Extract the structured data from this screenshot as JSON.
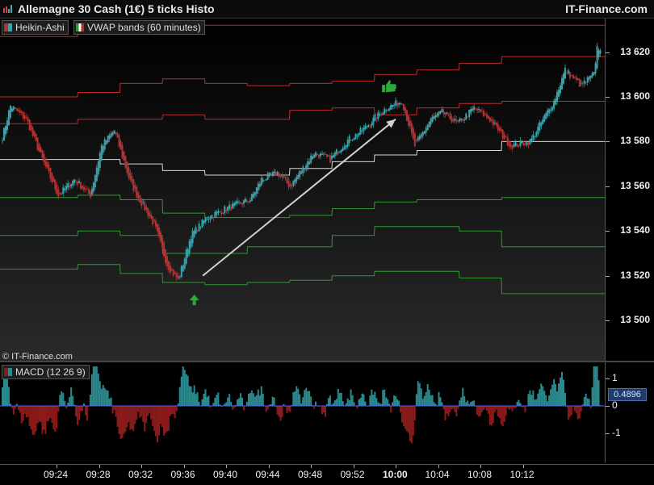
{
  "window": {
    "title": "Allemagne 30 Cash (1€) 5 ticks Histo",
    "brand": "IT-Finance.com",
    "copyright": "© IT-Finance.com"
  },
  "legends": {
    "main": [
      {
        "label": "Heikin-Ashi",
        "icon": "heikin-ashi-icon",
        "color": "#5a8fb0"
      },
      {
        "label": "VWAP bands (60 minutes)",
        "icon": "vwap-bands-icon",
        "color": "#c0392b"
      }
    ],
    "macd": {
      "label": "MACD (12 26 9)",
      "icon": "macd-icon",
      "color": "#8b0000"
    }
  },
  "colors": {
    "bull": "#3ea0a8",
    "bear": "#b03232",
    "upper_band": "#c0282a",
    "vwap": "#d8d8d8",
    "lower_band": "#2e9a2e",
    "macd_pos": "#2a8a8e",
    "macd_neg": "#8b1a1a",
    "arrow": "#d0d0d0",
    "signal_up": "#2eaa3a"
  },
  "chart_data": [
    {
      "type": "candlestick",
      "title": "Allemagne 30 Cash (1€) 5 ticks Histo",
      "ylim": [
        13482,
        13635
      ],
      "y_ticks": [
        13500,
        13520,
        13540,
        13560,
        13580,
        13600,
        13620
      ],
      "y_tick_labels": [
        "13 500",
        "13 520",
        "13 540",
        "13 560",
        "13 580",
        "13 600",
        "13 620"
      ],
      "x_tick_labels": [
        "09:24",
        "09:28",
        "09:32",
        "09:36",
        "09:40",
        "09:44",
        "09:48",
        "09:52",
        "10:00",
        "10:04",
        "10:08",
        "10:12"
      ],
      "x_ticks_bold": [
        "10:00"
      ],
      "grid": false,
      "price_anchors": [
        [
          0,
          13582
        ],
        [
          5,
          13596
        ],
        [
          15,
          13590
        ],
        [
          25,
          13572
        ],
        [
          35,
          13556
        ],
        [
          45,
          13563
        ],
        [
          55,
          13556
        ],
        [
          62,
          13578
        ],
        [
          70,
          13585
        ],
        [
          80,
          13562
        ],
        [
          85,
          13555
        ],
        [
          95,
          13543
        ],
        [
          103,
          13525
        ],
        [
          110,
          13518
        ],
        [
          118,
          13538
        ],
        [
          128,
          13546
        ],
        [
          140,
          13550
        ],
        [
          155,
          13554
        ],
        [
          162,
          13563
        ],
        [
          172,
          13566
        ],
        [
          180,
          13560
        ],
        [
          195,
          13575
        ],
        [
          205,
          13572
        ],
        [
          215,
          13580
        ],
        [
          225,
          13585
        ],
        [
          240,
          13595
        ],
        [
          250,
          13598
        ],
        [
          258,
          13578
        ],
        [
          268,
          13590
        ],
        [
          275,
          13593
        ],
        [
          285,
          13588
        ],
        [
          295,
          13595
        ],
        [
          305,
          13590
        ],
        [
          318,
          13578
        ],
        [
          330,
          13580
        ],
        [
          345,
          13598
        ],
        [
          352,
          13612
        ],
        [
          362,
          13605
        ],
        [
          370,
          13610
        ],
        [
          372,
          13622
        ]
      ],
      "series": [
        {
          "name": "VWAP bands (60 minutes)",
          "role": "upper2",
          "values": [
            13627,
            13629,
            13631,
            13632,
            13632,
            13632,
            13632,
            13632,
            13632,
            13632,
            13632,
            13632
          ]
        },
        {
          "name": "VWAP bands (60 minutes)",
          "role": "upper1",
          "values": [
            13600,
            13602,
            13606,
            13608,
            13606,
            13605,
            13606,
            13607,
            13610,
            13612,
            13615,
            13618
          ]
        },
        {
          "name": "VWAP bands (60 minutes)",
          "role": "upper0",
          "values": [
            13588,
            13590,
            13590,
            13592,
            13590,
            13590,
            13594,
            13595,
            13592,
            13595,
            13597,
            13598
          ]
        },
        {
          "name": "VWAP bands (60 minutes)",
          "role": "vwap",
          "values": [
            13572,
            13572,
            13570,
            13567,
            13565,
            13565,
            13568,
            13571,
            13574,
            13576,
            13576,
            13580
          ]
        },
        {
          "name": "VWAP bands (60 minutes)",
          "role": "lower0",
          "values": [
            13555,
            13556,
            13554,
            13548,
            13546,
            13546,
            13547,
            13550,
            13553,
            13554,
            13554,
            13555
          ]
        },
        {
          "name": "VWAP bands (60 minutes)",
          "role": "lower1",
          "values": [
            13538,
            13540,
            13538,
            13530,
            13530,
            13533,
            13533,
            13538,
            13542,
            13542,
            13540,
            13533
          ]
        },
        {
          "name": "VWAP bands (60 minutes)",
          "role": "lower2",
          "values": [
            13523,
            13525,
            13521,
            13517,
            13516,
            13517,
            13518,
            13520,
            13522,
            13522,
            13519,
            13512
          ]
        }
      ],
      "annotations": [
        {
          "kind": "arrow-up-signal",
          "time_index": 3.25,
          "price": 13513
        },
        {
          "kind": "thumbs-up-signal",
          "time_index": 7.85,
          "price": 13601
        },
        {
          "kind": "trend-arrow",
          "from": [
            3.45,
            13520
          ],
          "to": [
            8.0,
            13590
          ]
        }
      ]
    },
    {
      "type": "histogram",
      "title": "MACD (12 26 9)",
      "ylim": [
        -2.1,
        1.6
      ],
      "y_ticks": [
        1,
        0,
        -1
      ],
      "y_tick_labels": [
        "1",
        "0",
        "-1"
      ],
      "last_value": "0.4896",
      "zero_line": true
    }
  ]
}
